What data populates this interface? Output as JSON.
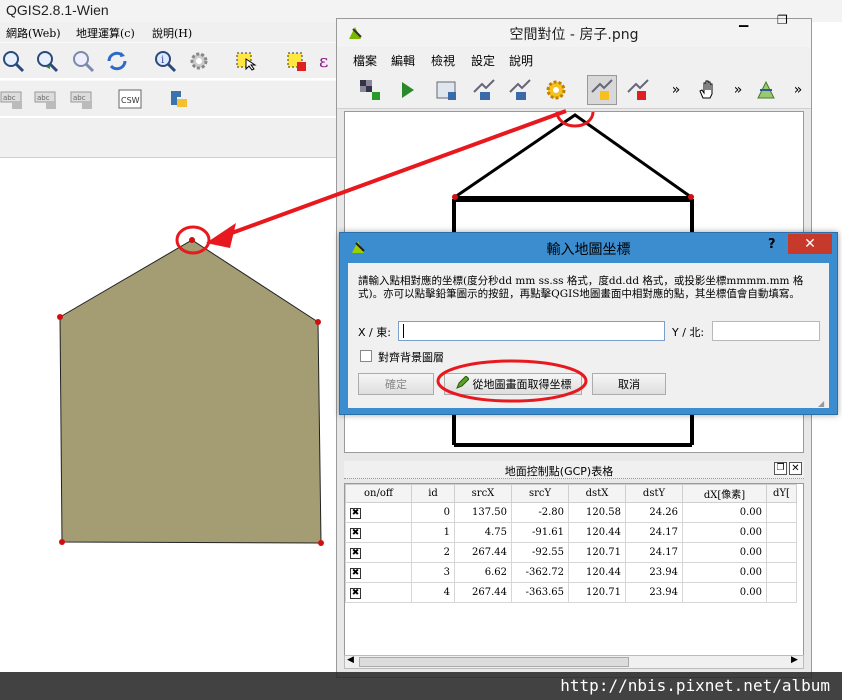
{
  "qgis": {
    "title": "QGIS2.8.1-Wien",
    "menu": [
      "網路(Web)",
      "地理運算(c)",
      "說明(H)"
    ]
  },
  "georef": {
    "title": "空間對位 - 房子.png",
    "menu": [
      "檔案",
      "編輯",
      "檢視",
      "設定",
      "說明"
    ],
    "gcp_title": "地面控制點(GCP)表格",
    "columns": [
      "on/off",
      "id",
      "srcX",
      "srcY",
      "dstX",
      "dstY",
      "dX[像素]",
      "dY["
    ],
    "rows": [
      {
        "on": "✖",
        "id": "0",
        "srcX": "137.50",
        "srcY": "-2.80",
        "dstX": "120.58",
        "dstY": "24.26",
        "dX": "0.00"
      },
      {
        "on": "✖",
        "id": "1",
        "srcX": "4.75",
        "srcY": "-91.61",
        "dstX": "120.44",
        "dstY": "24.17",
        "dX": "0.00"
      },
      {
        "on": "✖",
        "id": "2",
        "srcX": "267.44",
        "srcY": "-92.55",
        "dstX": "120.71",
        "dstY": "24.17",
        "dX": "0.00"
      },
      {
        "on": "✖",
        "id": "3",
        "srcX": "6.62",
        "srcY": "-362.72",
        "dstX": "120.44",
        "dstY": "23.94",
        "dX": "0.00"
      },
      {
        "on": "✖",
        "id": "4",
        "srcX": "267.44",
        "srcY": "-363.65",
        "dstX": "120.71",
        "dstY": "23.94",
        "dX": "0.00"
      }
    ]
  },
  "dialog": {
    "title": "輸入地圖坐標",
    "help": "?",
    "close": "✕",
    "instructions": "請輸入點相對應的坐標(度分秒dd mm ss.ss 格式，度dd.dd 格式，或投影坐標mmmm.mm 格式)。亦可以點擊鉛筆圖示的按鈕，再點擊QGIS地圖畫面中相對應的點，其坐標值會自動填寫。",
    "x_label": "X / 東:",
    "x_value": "",
    "y_label": "Y / 北:",
    "y_value": "",
    "snap_label": "對齊背景圖層",
    "ok_label": "確定",
    "from_canvas_label": "從地圖畫面取得坐標",
    "cancel_label": "取消"
  },
  "watermark": "http://nbis.pixnet.net/album",
  "colors": {
    "polygon_fill": "#a49d74",
    "annotation_red": "#e8191e",
    "dialog_frame": "#3c8dd0",
    "close_red": "#c7392a"
  }
}
